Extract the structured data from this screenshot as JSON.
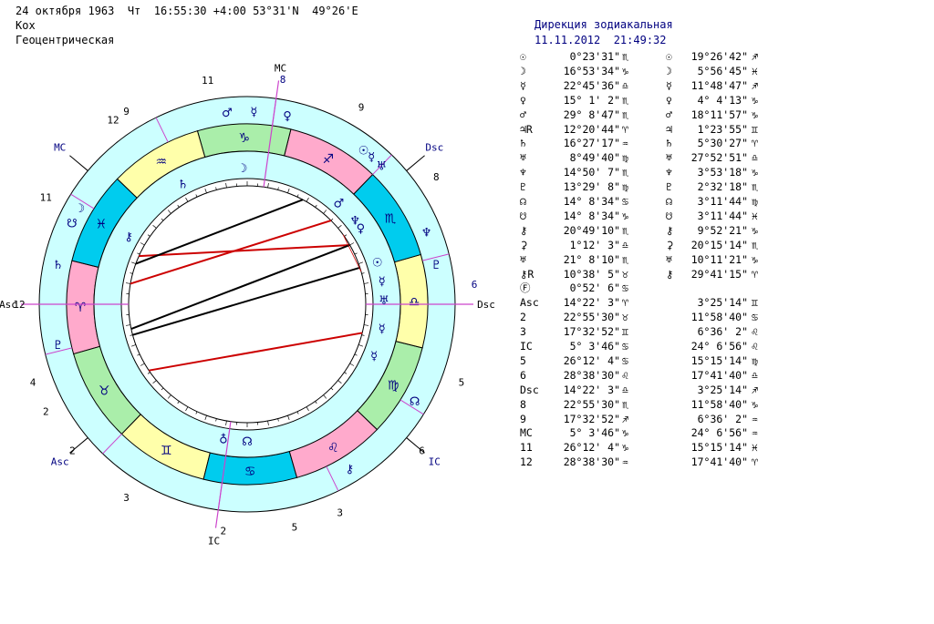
{
  "header": {
    "line1": "24 октября 1963  Чт  16:55:30 +4:00 53°31'N  49°26'E",
    "line2": "Кох",
    "line3": "Геоцентрическая"
  },
  "colors": {
    "fire": "#ffaacc",
    "earth": "#aaeeaa",
    "air": "#ffffaa",
    "water": "#00ccee",
    "ring": "#ccffff",
    "house_cusp": "#cc44cc",
    "aspect_red": "#cc0000",
    "aspect_black": "#000000",
    "label_blue": "#000080"
  },
  "wheel": {
    "asc_label": "Asc",
    "dsc_label": "Dsc",
    "mc_label": "MC",
    "ic_label": "IC",
    "signs": [
      "♈",
      "♉",
      "♊",
      "♋",
      "♌",
      "♍",
      "♎",
      "♏",
      "♐",
      "♑",
      "♒",
      "♓"
    ],
    "planet_glyphs": {
      "sun": "☉",
      "moon": "☽",
      "mercury": "☿",
      "venus": "♀",
      "mars": "♂",
      "jupiter": "♃",
      "saturn": "♄",
      "uranus": "♅",
      "neptune": "♆",
      "pluto": "♇",
      "node": "☊",
      "snode": "☋",
      "chiron": "⚷",
      "proserpina": "⚳",
      "lilith": "♅",
      "rtrop": "♁"
    },
    "outer_house_numbers": [
      {
        "text": "12",
        "deg": 180
      },
      {
        "text": "11",
        "deg": 152
      },
      {
        "text": "9",
        "deg": 122
      },
      {
        "text": "11",
        "deg": 100
      },
      {
        "text": "8",
        "deg": 81
      },
      {
        "text": "9",
        "deg": 60
      },
      {
        "text": "8",
        "deg": 34
      },
      {
        "text": "6",
        "deg": 5
      },
      {
        "text": "5",
        "deg": -20
      },
      {
        "text": "3",
        "deg": -66
      },
      {
        "text": "5",
        "deg": -78
      },
      {
        "text": "2",
        "deg": -96
      },
      {
        "text": "3",
        "deg": -122
      },
      {
        "text": "2",
        "deg": -152
      },
      {
        "text": "4",
        "deg": -160
      },
      {
        "text": "2",
        "deg": -140
      },
      {
        "text": "6",
        "deg": -40
      },
      {
        "text": "12",
        "deg": 126
      }
    ]
  },
  "table": {
    "title": "Дирекция зодиакальная",
    "datetime": "11.11.2012  21:49:32",
    "rows": [
      {
        "glyph": "☉",
        "natal": "0°23'31\"",
        "ns": "♏",
        "glyph2": "☉",
        "dir": "19°26'42\"",
        "ds": "♐"
      },
      {
        "glyph": "☽",
        "natal": "16°53'34\"",
        "ns": "♑",
        "glyph2": "☽",
        "dir": "5°56'45\"",
        "ds": "♓"
      },
      {
        "glyph": "☿",
        "natal": "22°45'36\"",
        "ns": "♎",
        "glyph2": "☿",
        "dir": "11°48'47\"",
        "ds": "♐"
      },
      {
        "glyph": "♀",
        "natal": "15° 1' 2\"",
        "ns": "♏",
        "glyph2": "♀",
        "dir": "4° 4'13\"",
        "ds": "♑"
      },
      {
        "glyph": "♂",
        "natal": "29° 8'47\"",
        "ns": "♏",
        "glyph2": "♂",
        "dir": "18°11'57\"",
        "ds": "♑"
      },
      {
        "glyph": "♃R",
        "natal": "12°20'44\"",
        "ns": "♈",
        "glyph2": "♃",
        "dir": "1°23'55\"",
        "ds": "♊"
      },
      {
        "glyph": "♄",
        "natal": "16°27'17\"",
        "ns": "♒",
        "glyph2": "♄",
        "dir": "5°30'27\"",
        "ds": "♈"
      },
      {
        "glyph": "♅",
        "natal": "8°49'40\"",
        "ns": "♍",
        "glyph2": "♅",
        "dir": "27°52'51\"",
        "ds": "♎"
      },
      {
        "glyph": "♆",
        "natal": "14°50' 7\"",
        "ns": "♏",
        "glyph2": "♆",
        "dir": "3°53'18\"",
        "ds": "♑"
      },
      {
        "glyph": "♇",
        "natal": "13°29' 8\"",
        "ns": "♍",
        "glyph2": "♇",
        "dir": "2°32'18\"",
        "ds": "♏"
      },
      {
        "glyph": "☊",
        "natal": "14° 8'34\"",
        "ns": "♋",
        "glyph2": "☊",
        "dir": "3°11'44\"",
        "ds": "♍"
      },
      {
        "glyph": "☋",
        "natal": "14° 8'34\"",
        "ns": "♑",
        "glyph2": "☋",
        "dir": "3°11'44\"",
        "ds": "♓"
      },
      {
        "glyph": "⚷",
        "natal": "20°49'10\"",
        "ns": "♏",
        "glyph2": "⚷",
        "dir": "9°52'21\"",
        "ds": "♑"
      },
      {
        "glyph": "⚳",
        "natal": "1°12' 3\"",
        "ns": "♎",
        "glyph2": "⚳",
        "dir": "20°15'14\"",
        "ds": "♏"
      },
      {
        "glyph": "♅",
        "natal": "21° 8'10\"",
        "ns": "♏",
        "glyph2": "♅",
        "dir": "10°11'21\"",
        "ds": "♑"
      },
      {
        "glyph": "⚷R",
        "natal": "10°38' 5\"",
        "ns": "♉",
        "glyph2": "⚷",
        "dir": "29°41'15\"",
        "ds": "♈"
      },
      {
        "glyph": "Ⓕ",
        "natal": "0°52' 6\"",
        "ns": "♋",
        "glyph2": "",
        "dir": "",
        "ds": ""
      },
      {
        "glyph": "Asc",
        "natal": "14°22' 3\"",
        "ns": "♈",
        "glyph2": "",
        "dir": "3°25'14\"",
        "ds": "♊"
      },
      {
        "glyph": "2",
        "natal": "22°55'30\"",
        "ns": "♉",
        "glyph2": "",
        "dir": "11°58'40\"",
        "ds": "♋"
      },
      {
        "glyph": "3",
        "natal": "17°32'52\"",
        "ns": "♊",
        "glyph2": "",
        "dir": "6°36' 2\"",
        "ds": "♌"
      },
      {
        "glyph": "IC",
        "natal": "5° 3'46\"",
        "ns": "♋",
        "glyph2": "",
        "dir": "24° 6'56\"",
        "ds": "♌"
      },
      {
        "glyph": "5",
        "natal": "26°12' 4\"",
        "ns": "♋",
        "glyph2": "",
        "dir": "15°15'14\"",
        "ds": "♍"
      },
      {
        "glyph": "6",
        "natal": "28°38'30\"",
        "ns": "♌",
        "glyph2": "",
        "dir": "17°41'40\"",
        "ds": "♎"
      },
      {
        "glyph": "Dsc",
        "natal": "14°22' 3\"",
        "ns": "♎",
        "glyph2": "",
        "dir": "3°25'14\"",
        "ds": "♐"
      },
      {
        "glyph": "8",
        "natal": "22°55'30\"",
        "ns": "♏",
        "glyph2": "",
        "dir": "11°58'40\"",
        "ds": "♑"
      },
      {
        "glyph": "9",
        "natal": "17°32'52\"",
        "ns": "♐",
        "glyph2": "",
        "dir": "6°36' 2\"",
        "ds": "♒"
      },
      {
        "glyph": "MC",
        "natal": "5° 3'46\"",
        "ns": "♑",
        "glyph2": "",
        "dir": "24° 6'56\"",
        "ds": "♒"
      },
      {
        "glyph": "11",
        "natal": "26°12' 4\"",
        "ns": "♑",
        "glyph2": "",
        "dir": "15°15'14\"",
        "ds": "♓"
      },
      {
        "glyph": "12",
        "natal": "28°38'30\"",
        "ns": "♒",
        "glyph2": "",
        "dir": "17°41'40\"",
        "ds": "♈"
      }
    ]
  }
}
